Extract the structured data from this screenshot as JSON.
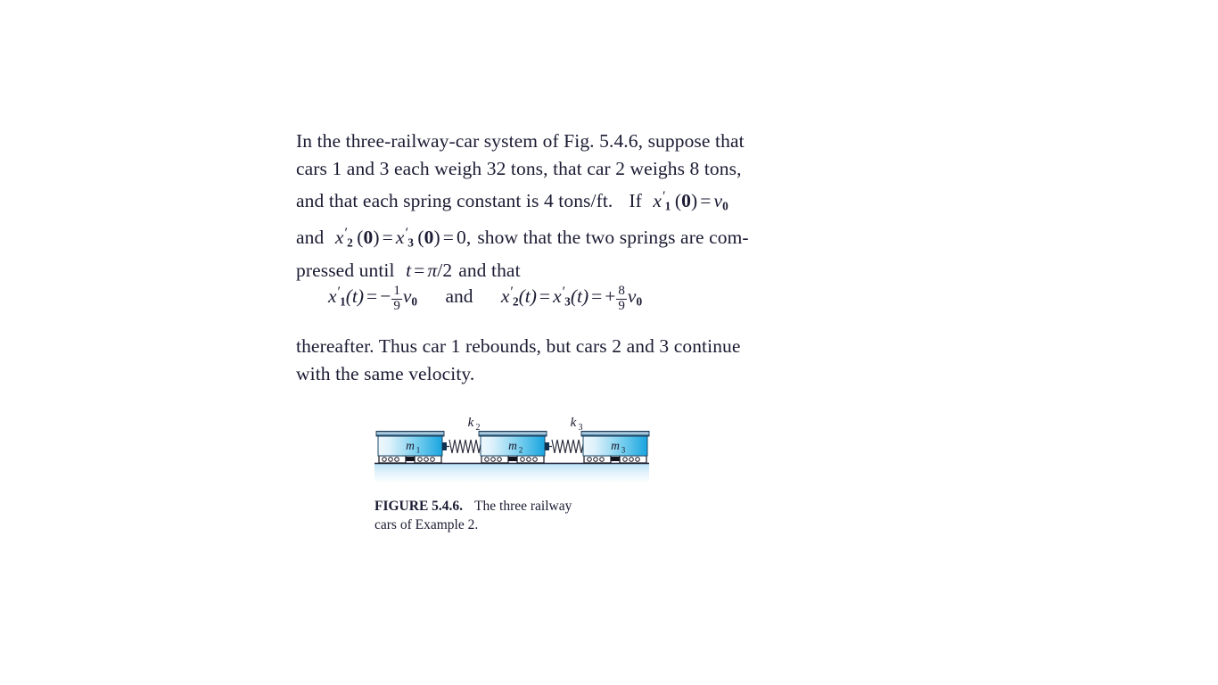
{
  "page": {
    "background": "#ffffff",
    "text_color": "#1b1b33"
  },
  "problem": {
    "lines": [
      "In the three-railway-car system of Fig. 5.4.6, suppose that",
      "cars 1 and 3 each weigh 32 tons, that car 2 weighs 8 tons,",
      "and that each spring constant is 4 tons/ft. If",
      "and",
      "pressed until"
    ],
    "line1": "In the three-railway-car system of Fig. 5.4.6, suppose that",
    "line2": "cars 1 and 3 each weigh 32 tons, that car 2 weighs 8 tons,",
    "line3_a": "and that each spring constant is 4 tons/ft.",
    "line3_b": "If",
    "line3_math": "x₁′(0) = v₀",
    "line4_a": "and",
    "line4_math": "x₂′(0) = x₃′(0) = 0,",
    "line4_b": "show that the two springs are com-",
    "line5_a": "pressed until",
    "line5_math": "t = π/2",
    "line5_b": "and that",
    "conclusion_line1": "thereafter. Thus car 1 rebounds, but cars 2 and 3 continue",
    "conclusion_line2": "with the same velocity."
  },
  "equation": {
    "lhs_var": "x",
    "lhs_sub": "1",
    "lhs_prime": "′",
    "lhs_arg": "(t)",
    "equals": "=",
    "minus": "−",
    "frac1_num": "1",
    "frac1_den": "9",
    "v": "v",
    "v_sub": "0",
    "and": "and",
    "rhs1_var": "x",
    "rhs1_sub": "2",
    "rhs2_var": "x",
    "rhs2_sub": "3",
    "plus": "+",
    "frac2_num": "8",
    "frac2_den": "9"
  },
  "figure": {
    "cars": [
      {
        "label": "m",
        "subscript": "1"
      },
      {
        "label": "m",
        "subscript": "2"
      },
      {
        "label": "m",
        "subscript": "3"
      }
    ],
    "springs": [
      {
        "label": "k",
        "subscript": "2"
      },
      {
        "label": "k",
        "subscript": "3"
      }
    ],
    "colors": {
      "car_body_light": "#e8f6fd",
      "car_body_dark": "#1fa8e0",
      "car_top_rail": "#12314f",
      "ground_line": "#1b1b33",
      "ground_fill_top": "#bfe4f7",
      "ground_fill_bottom": "#ffffff",
      "spring": "#2a2a3a",
      "wheel_outline": "#14141e"
    }
  },
  "caption": {
    "figure_label": "FIGURE 5.4.6.",
    "text_line1": "The three railway",
    "text_line2": "cars of Example 2."
  }
}
